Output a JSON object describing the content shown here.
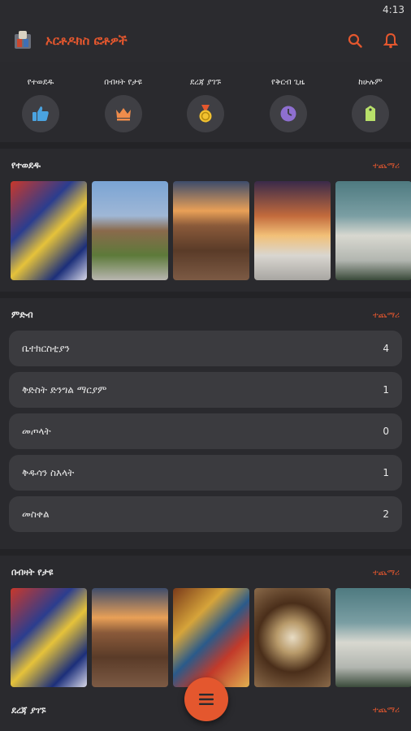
{
  "status": {
    "time": "4:13"
  },
  "app": {
    "title": "ኦርቶዶክስ ፎቶዎች"
  },
  "quicknav": [
    {
      "label": "የተወደዱ",
      "icon": "thumbs-up-icon",
      "color": "#4aa3e0"
    },
    {
      "label": "በብዛት የታዩ",
      "icon": "crown-icon",
      "color": "#f08c4b"
    },
    {
      "label": "ደረጃ ያገኙ",
      "icon": "medal-icon",
      "color": "#f2c230"
    },
    {
      "label": "የቅርብ ጊዜ",
      "icon": "clock-icon",
      "color": "#8e6fd0"
    },
    {
      "label": "ከሁሉም",
      "icon": "tag-icon",
      "color": "#b8e06a"
    }
  ],
  "sections": {
    "favorites": {
      "title": "የተወደዱ",
      "more": "ተጨማሪ"
    },
    "categories": {
      "title": "ምድብ",
      "more": "ተጨማሪ",
      "items": [
        {
          "label": "ቤተክርስቲያን",
          "count": "4"
        },
        {
          "label": "ቅድስት ድንግል ማርያም",
          "count": "1"
        },
        {
          "label": "መጦላት",
          "count": "0"
        },
        {
          "label": "ቅዱሳን ስእላት",
          "count": "1"
        },
        {
          "label": "መስቀል",
          "count": "2"
        }
      ]
    },
    "most_viewed": {
      "title": "በብዛት የታዩ",
      "more": "ተጨማሪ"
    },
    "ranked": {
      "title": "ደረጃ ያገኙ",
      "more": "ተጨማሪ"
    }
  },
  "colors": {
    "accent": "#e4572e",
    "background": "#2a2a2e",
    "card": "#3b3b3f"
  }
}
